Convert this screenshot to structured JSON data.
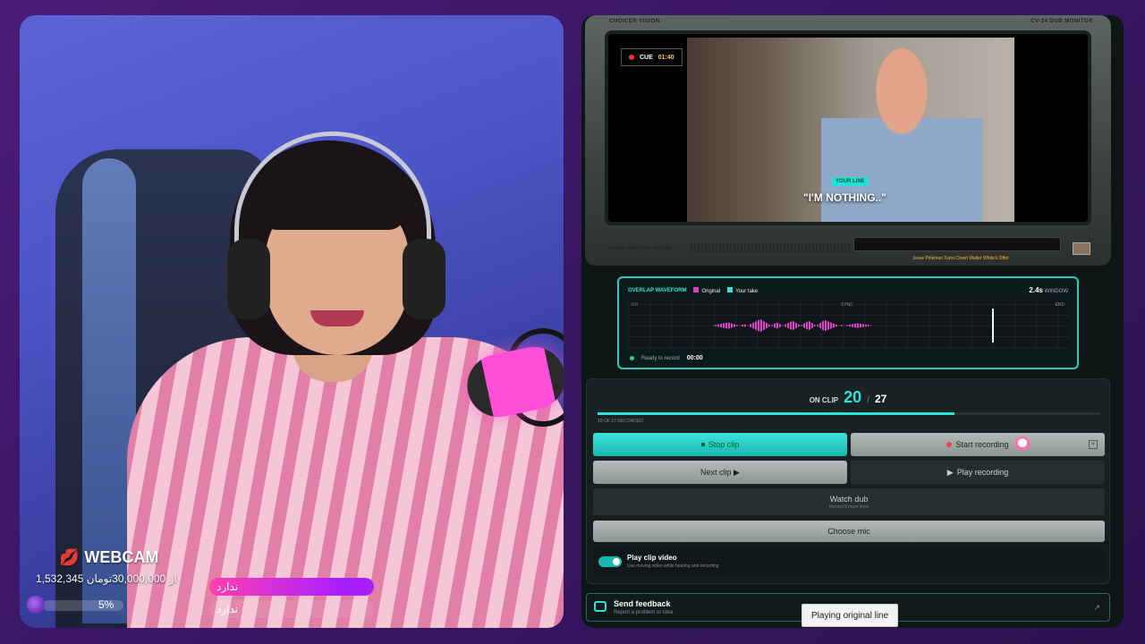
{
  "webcam": {
    "label": "WEBCAM",
    "lips_icon": "lips-icon",
    "donation_text": "1,532,345 از 30,000,000تومان",
    "progress_percent": "5%",
    "progress_fraction": 0.05,
    "pill_top": "ندارد",
    "pill_bottom": "ندارد"
  },
  "monitor": {
    "brand_left": "CHOICER VISION",
    "brand_right": "CV-34 DUB MONITOR",
    "cue_label": "CUE",
    "cue_time": "01:40",
    "your_line_tag": "YOUR LINE",
    "subtitle": "\"I'M NOTHING..\"",
    "stats_left": "FRAME HOLD   02:24 MASTER",
    "episode_title": "Jesse Pinkman Turns Down Walter White's Offer"
  },
  "waveform": {
    "title": "OVERLAP WAVEFORM",
    "legend_original": "Original",
    "legend_take": "Your take",
    "window_value": "2.4s",
    "window_label": "WINDOW",
    "tick_start": "0.0",
    "tick_mid": "SYNC",
    "tick_end": "END",
    "status_text": "Ready to record",
    "status_time": "00:00",
    "colors": {
      "original": "#e040d0",
      "take": "#2fe3d8"
    }
  },
  "controls": {
    "on_clip_label": "ON CLIP",
    "current_clip": "20",
    "separator": "/",
    "total_clips": "27",
    "clip_progress_fraction": 0.71,
    "recorded_text": "19 OF 27 RECORDED",
    "stop_clip": "Stop clip",
    "start_recording": "Start recording",
    "next_clip": "Next clip ▶",
    "play_recording": "Play recording",
    "watch_dub": "Watch dub",
    "watch_dub_sub": "Record 8 more lines",
    "choose_mic": "Choose mic",
    "play_clip_video_title": "Play clip video",
    "play_clip_video_sub": "Use moving video while hearing and recording",
    "play_clip_video_on": true
  },
  "feedback": {
    "title": "Send feedback",
    "subtitle": "Report a problem or idea"
  },
  "tooltip": "Playing original line",
  "colors": {
    "accent": "#2fe3d8",
    "background": "#4a1c7a",
    "record_dot": "#ff3a4a"
  }
}
